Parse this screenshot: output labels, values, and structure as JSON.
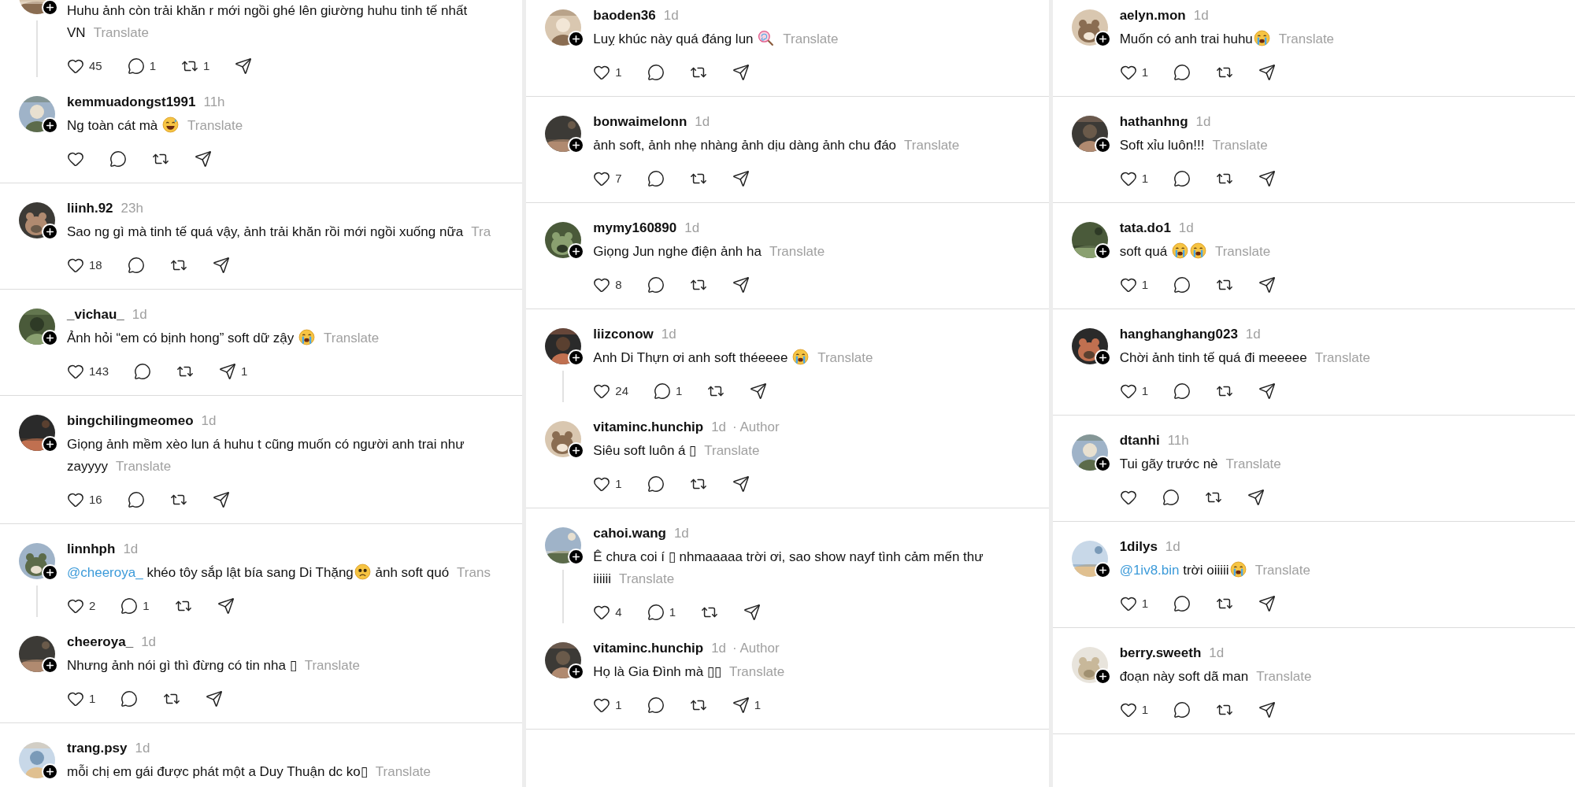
{
  "columns": [
    {
      "threads": [
        {
          "comments": [
            {
              "text": [
                {
                  "kind": "text",
                  "text": "Huhu ảnh còn trải khăn r mới ngồi ghé lên giường huhu tinh tế nhất VN"
                }
              ],
              "translate": "Translate",
              "actions": [
                {
                  "kind": "like",
                  "count": "45"
                },
                {
                  "kind": "reply",
                  "count": "1"
                },
                {
                  "kind": "repost",
                  "count": "1"
                },
                {
                  "kind": "share"
                }
              ]
            },
            {
              "username": "kemmuadongst1991",
              "time": "11h",
              "text": [
                {
                  "kind": "text",
                  "text": "Ng toàn cát mà "
                },
                {
                  "kind": "sweat-smile"
                }
              ],
              "translate": "Translate",
              "actions": [
                {
                  "kind": "like"
                },
                {
                  "kind": "reply"
                },
                {
                  "kind": "repost"
                },
                {
                  "kind": "share"
                }
              ]
            }
          ]
        },
        {
          "comments": [
            {
              "username": "liinh.92",
              "time": "23h",
              "text": [
                {
                  "kind": "text",
                  "text": "Sao ng gì mà tinh tế quá vậy, ảnh trải khăn rồi mới ngồi xuống nữa"
                }
              ],
              "translate": "Tra",
              "actions": [
                {
                  "kind": "like",
                  "count": "18"
                },
                {
                  "kind": "reply"
                },
                {
                  "kind": "repost"
                },
                {
                  "kind": "share"
                }
              ]
            }
          ]
        },
        {
          "comments": [
            {
              "username": "_vichau_",
              "time": "1d",
              "text": [
                {
                  "kind": "text",
                  "text": "Ảnh hỏi “em có bịnh hong” soft dữ zậy "
                },
                {
                  "kind": "crying"
                }
              ],
              "translate": "Translate",
              "actions": [
                {
                  "kind": "like",
                  "count": "143"
                },
                {
                  "kind": "reply"
                },
                {
                  "kind": "repost"
                },
                {
                  "kind": "share",
                  "count": "1"
                }
              ]
            }
          ]
        },
        {
          "comments": [
            {
              "username": "bingchilingmeomeo",
              "time": "1d",
              "text": [
                {
                  "kind": "text",
                  "text": "Giọng ảnh mềm xèo lun á huhu t cũng muốn có người anh trai như zayyyy"
                }
              ],
              "translate": "Translate",
              "actions": [
                {
                  "kind": "like",
                  "count": "16"
                },
                {
                  "kind": "reply"
                },
                {
                  "kind": "repost"
                },
                {
                  "kind": "share"
                }
              ]
            }
          ]
        },
        {
          "comments": [
            {
              "username": "linnhph",
              "time": "1d",
              "text": [
                {
                  "kind": "mention",
                  "text": "@cheeroya_"
                },
                {
                  "kind": "text",
                  "text": " khéo tôy sắp lật bía sang Di Thặng"
                },
                {
                  "kind": "worried"
                },
                {
                  "kind": "text",
                  "text": " ảnh soft quó"
                }
              ],
              "translate": "Trans",
              "actions": [
                {
                  "kind": "like",
                  "count": "2"
                },
                {
                  "kind": "reply",
                  "count": "1"
                },
                {
                  "kind": "repost"
                },
                {
                  "kind": "share"
                }
              ]
            },
            {
              "username": "cheeroya_",
              "time": "1d",
              "text": [
                {
                  "kind": "text",
                  "text": "Nhưng ảnh nói gì thì đừng có tin nha ▯"
                }
              ],
              "translate": "Translate",
              "actions": [
                {
                  "kind": "like",
                  "count": "1"
                },
                {
                  "kind": "reply"
                },
                {
                  "kind": "repost"
                },
                {
                  "kind": "share"
                }
              ]
            }
          ]
        },
        {
          "comments": [
            {
              "username": "trang.psy",
              "time": "1d",
              "text": [
                {
                  "kind": "text",
                  "text": "mỗi chị em gái được phát một a Duy Thuận dc ko▯"
                }
              ],
              "translate": "Translate"
            }
          ]
        }
      ]
    },
    {
      "threads": [
        {
          "comments": [
            {
              "username": "baoden36",
              "time": "1d",
              "text": [
                {
                  "kind": "text",
                  "text": "Luỵ khúc này quá đáng lun "
                },
                {
                  "kind": "lollipop"
                }
              ],
              "translate": "Translate",
              "actions": [
                {
                  "kind": "like",
                  "count": "1"
                },
                {
                  "kind": "reply"
                },
                {
                  "kind": "repost"
                },
                {
                  "kind": "share"
                }
              ]
            }
          ]
        },
        {
          "comments": [
            {
              "username": "bonwaimelonn",
              "time": "1d",
              "text": [
                {
                  "kind": "text",
                  "text": "ảnh soft, ảnh nhẹ nhàng ảnh dịu dàng ảnh chu đáo"
                }
              ],
              "translate": "Translate",
              "actions": [
                {
                  "kind": "like",
                  "count": "7"
                },
                {
                  "kind": "reply"
                },
                {
                  "kind": "repost"
                },
                {
                  "kind": "share"
                }
              ]
            }
          ]
        },
        {
          "comments": [
            {
              "username": "mymy160890",
              "time": "1d",
              "text": [
                {
                  "kind": "text",
                  "text": "Giọng Jun nghe điện ảnh ha"
                }
              ],
              "translate": "Translate",
              "actions": [
                {
                  "kind": "like",
                  "count": "8"
                },
                {
                  "kind": "reply"
                },
                {
                  "kind": "repost"
                },
                {
                  "kind": "share"
                }
              ]
            }
          ]
        },
        {
          "comments": [
            {
              "username": "liizconow",
              "time": "1d",
              "text": [
                {
                  "kind": "text",
                  "text": "Anh Di Thựn ơi anh soft théeeee "
                },
                {
                  "kind": "crying"
                }
              ],
              "translate": "Translate",
              "actions": [
                {
                  "kind": "like",
                  "count": "24"
                },
                {
                  "kind": "reply",
                  "count": "1"
                },
                {
                  "kind": "repost"
                },
                {
                  "kind": "share"
                }
              ]
            },
            {
              "username": "vitaminc.hunchip",
              "time": "1d",
              "author_label": "· Author",
              "text": [
                {
                  "kind": "text",
                  "text": "Siêu soft luôn á ▯"
                }
              ],
              "translate": "Translate",
              "actions": [
                {
                  "kind": "like",
                  "count": "1"
                },
                {
                  "kind": "reply"
                },
                {
                  "kind": "repost"
                },
                {
                  "kind": "share"
                }
              ]
            }
          ]
        },
        {
          "comments": [
            {
              "username": "cahoi.wang",
              "time": "1d",
              "text": [
                {
                  "kind": "text",
                  "text": "Ê chưa coi í ▯ nhmaaaaa trời ơi, sao show nayf tình cảm mến thư\niiiiii"
                }
              ],
              "translate": "Translate",
              "actions": [
                {
                  "kind": "like",
                  "count": "4"
                },
                {
                  "kind": "reply",
                  "count": "1"
                },
                {
                  "kind": "repost"
                },
                {
                  "kind": "share"
                }
              ]
            },
            {
              "username": "vitaminc.hunchip",
              "time": "1d",
              "author_label": "· Author",
              "text": [
                {
                  "kind": "text",
                  "text": "Họ là Gia Đình mà ▯▯"
                }
              ],
              "translate": "Translate",
              "actions": [
                {
                  "kind": "like",
                  "count": "1"
                },
                {
                  "kind": "reply"
                },
                {
                  "kind": "repost"
                },
                {
                  "kind": "share",
                  "count": "1"
                }
              ]
            }
          ]
        }
      ]
    },
    {
      "threads": [
        {
          "comments": [
            {
              "username": "aelyn.mon",
              "time": "1d",
              "text": [
                {
                  "kind": "text",
                  "text": "Muốn có anh trai huhu"
                },
                {
                  "kind": "crying"
                }
              ],
              "translate": "Translate",
              "actions": [
                {
                  "kind": "like",
                  "count": "1"
                },
                {
                  "kind": "reply"
                },
                {
                  "kind": "repost"
                },
                {
                  "kind": "share"
                }
              ]
            }
          ]
        },
        {
          "comments": [
            {
              "username": "hathanhng",
              "time": "1d",
              "text": [
                {
                  "kind": "text",
                  "text": "Soft xỉu luôn!!!"
                }
              ],
              "translate": "Translate",
              "actions": [
                {
                  "kind": "like",
                  "count": "1"
                },
                {
                  "kind": "reply"
                },
                {
                  "kind": "repost"
                },
                {
                  "kind": "share"
                }
              ]
            }
          ]
        },
        {
          "comments": [
            {
              "username": "tata.do1",
              "time": "1d",
              "text": [
                {
                  "kind": "text",
                  "text": "soft quá "
                },
                {
                  "kind": "crying"
                },
                {
                  "kind": "crying"
                }
              ],
              "translate": "Translate",
              "actions": [
                {
                  "kind": "like",
                  "count": "1"
                },
                {
                  "kind": "reply"
                },
                {
                  "kind": "repost"
                },
                {
                  "kind": "share"
                }
              ]
            }
          ]
        },
        {
          "comments": [
            {
              "username": "hanghanghang023",
              "time": "1d",
              "text": [
                {
                  "kind": "text",
                  "text": "Chời ảnh tinh tế quá đi meeeee"
                }
              ],
              "translate": "Translate",
              "actions": [
                {
                  "kind": "like",
                  "count": "1"
                },
                {
                  "kind": "reply"
                },
                {
                  "kind": "repost"
                },
                {
                  "kind": "share"
                }
              ]
            }
          ]
        },
        {
          "comments": [
            {
              "username": "dtanhi",
              "time": "11h",
              "text": [
                {
                  "kind": "text",
                  "text": "Tui gãy trước nè"
                }
              ],
              "translate": "Translate",
              "actions": [
                {
                  "kind": "like"
                },
                {
                  "kind": "reply"
                },
                {
                  "kind": "repost"
                },
                {
                  "kind": "share"
                }
              ]
            }
          ]
        },
        {
          "comments": [
            {
              "username": "1dilys",
              "time": "1d",
              "text": [
                {
                  "kind": "mention",
                  "text": "@1iv8.bin"
                },
                {
                  "kind": "text",
                  "text": " trời oiiiii"
                },
                {
                  "kind": "crying"
                }
              ],
              "translate": "Translate",
              "actions": [
                {
                  "kind": "like",
                  "count": "1"
                },
                {
                  "kind": "reply"
                },
                {
                  "kind": "repost"
                },
                {
                  "kind": "share"
                }
              ]
            }
          ]
        },
        {
          "comments": [
            {
              "username": "berry.sweeth",
              "time": "1d",
              "text": [
                {
                  "kind": "text",
                  "text": "đoạn này soft dã man"
                }
              ],
              "translate": "Translate",
              "actions": [
                {
                  "kind": "like",
                  "count": "1"
                },
                {
                  "kind": "reply"
                },
                {
                  "kind": "repost"
                },
                {
                  "kind": "share"
                }
              ]
            }
          ]
        }
      ]
    }
  ]
}
